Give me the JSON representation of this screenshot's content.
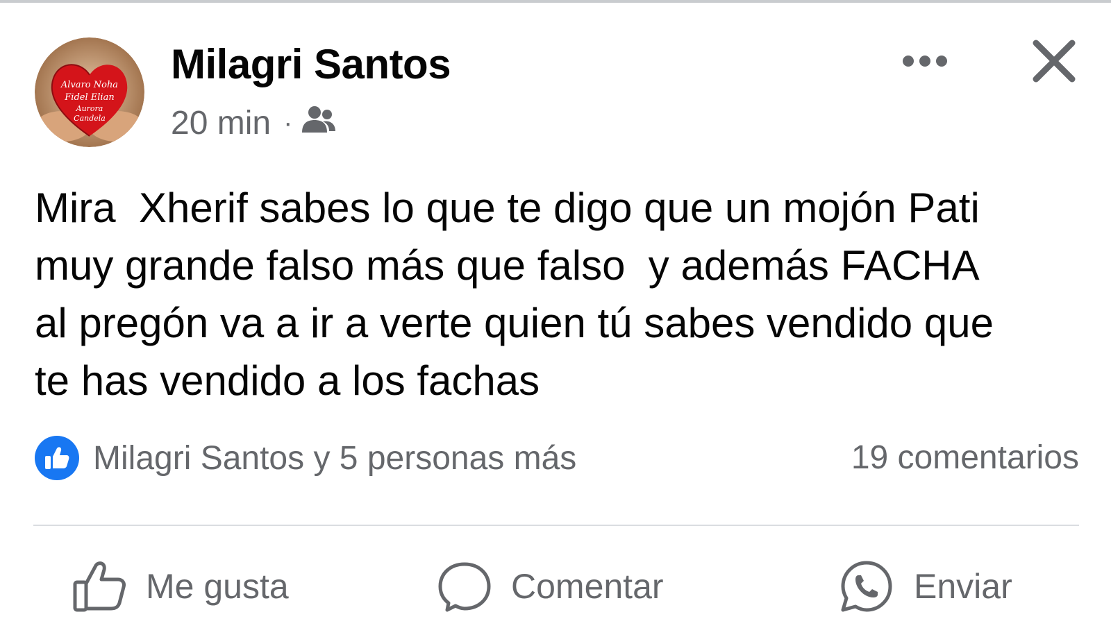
{
  "post": {
    "author": "Milagri Santos",
    "time": "20 min",
    "separator": "·",
    "audience_icon": "friends-icon",
    "avatar_text": [
      "Alvaro Noha",
      "Fidel Elian",
      "Aurora",
      "Candela"
    ],
    "body": "Mira  Xherif sabes lo que te digo que un mojón Pati\nmuy grande falso más que falso  y además FACHA\nal pregón va a ir a verte quien tú sabes vendido que\nte has vendido a los fachas",
    "reactions_text": "Milagri Santos y 5 personas más",
    "comments_text": "19 comentarios"
  },
  "actions": {
    "like": "Me gusta",
    "comment": "Comentar",
    "send": "Enviar"
  },
  "colors": {
    "brand_blue": "#1877f2",
    "secondary_text": "#65676b",
    "primary_text": "#050505",
    "avatar_heart": "#d4141a"
  }
}
